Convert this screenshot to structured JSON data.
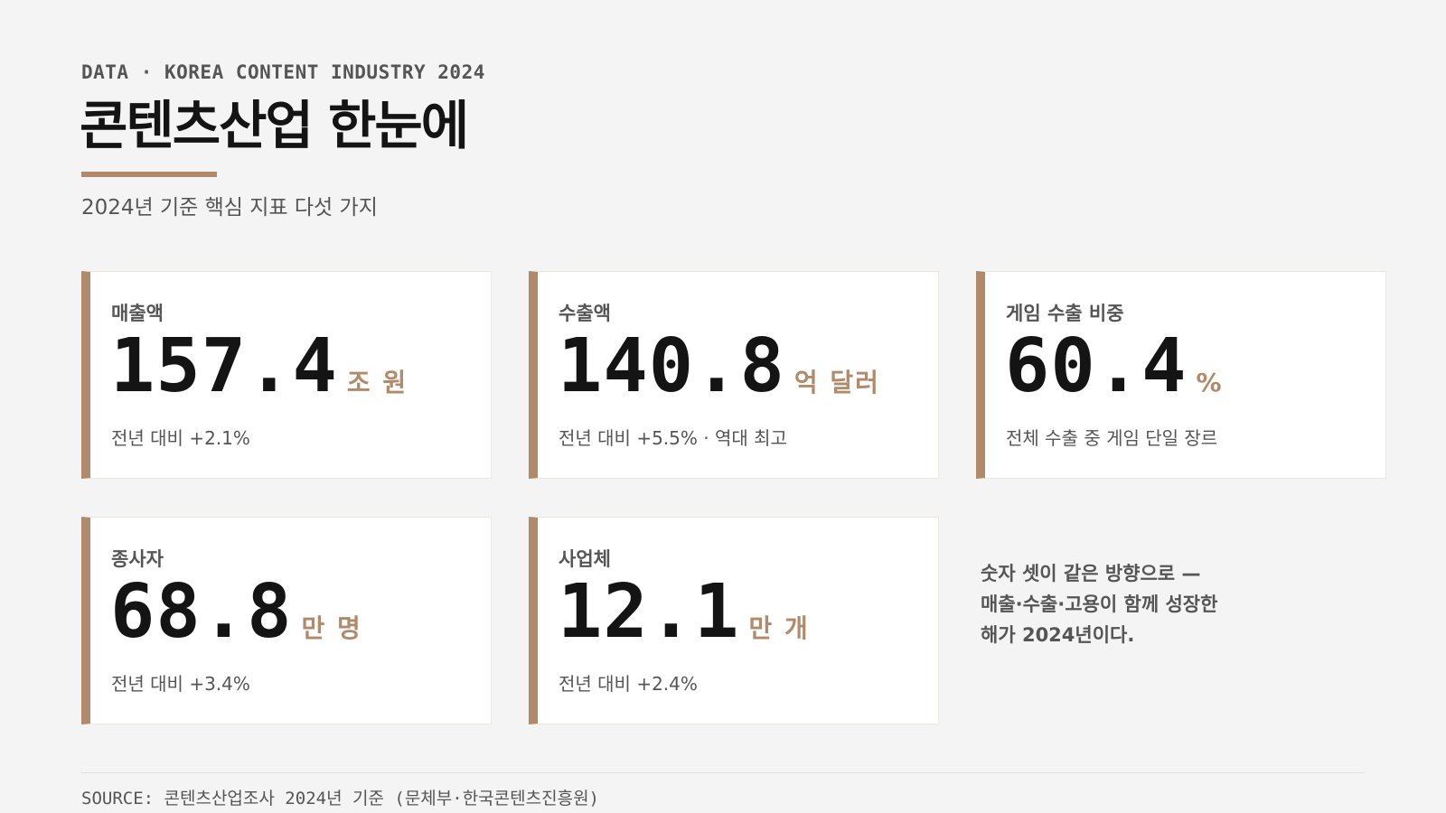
{
  "header": {
    "eyebrow": "DATA · KOREA CONTENT INDUSTRY 2024",
    "title": "콘텐츠산업 한눈에",
    "subtitle": "2024년 기준 핵심 지표 다섯 가지"
  },
  "cards": [
    {
      "label": "매출액",
      "value": "157.4",
      "unit": "조 원",
      "note": "전년 대비 +2.1%"
    },
    {
      "label": "수출액",
      "value": "140.8",
      "unit": "억 달러",
      "note": "전년 대비 +5.5% · 역대 최고"
    },
    {
      "label": "게임 수출 비중",
      "value": "60.4",
      "unit": "%",
      "note": "전체 수출 중 게임 단일 장르"
    },
    {
      "label": "종사자",
      "value": "68.8",
      "unit": "만 명",
      "note": "전년 대비 +3.4%"
    },
    {
      "label": "사업체",
      "value": "12.1",
      "unit": "만 개",
      "note": "전년 대비 +2.4%"
    }
  ],
  "closing": {
    "lines": [
      "숫자 셋이 같은 방향으로 —",
      "매출·수출·고용이 함께 성장한",
      "해가 2024년이다."
    ]
  },
  "footer": {
    "source": "SOURCE: 콘텐츠산업조사 2024년 기준 (문체부·한국콘텐츠진흥원)"
  },
  "colors": {
    "background": "#f4f4f4",
    "accent": "#b08a6a",
    "text": "#141414",
    "muted": "#555555",
    "card": "#ffffff"
  }
}
